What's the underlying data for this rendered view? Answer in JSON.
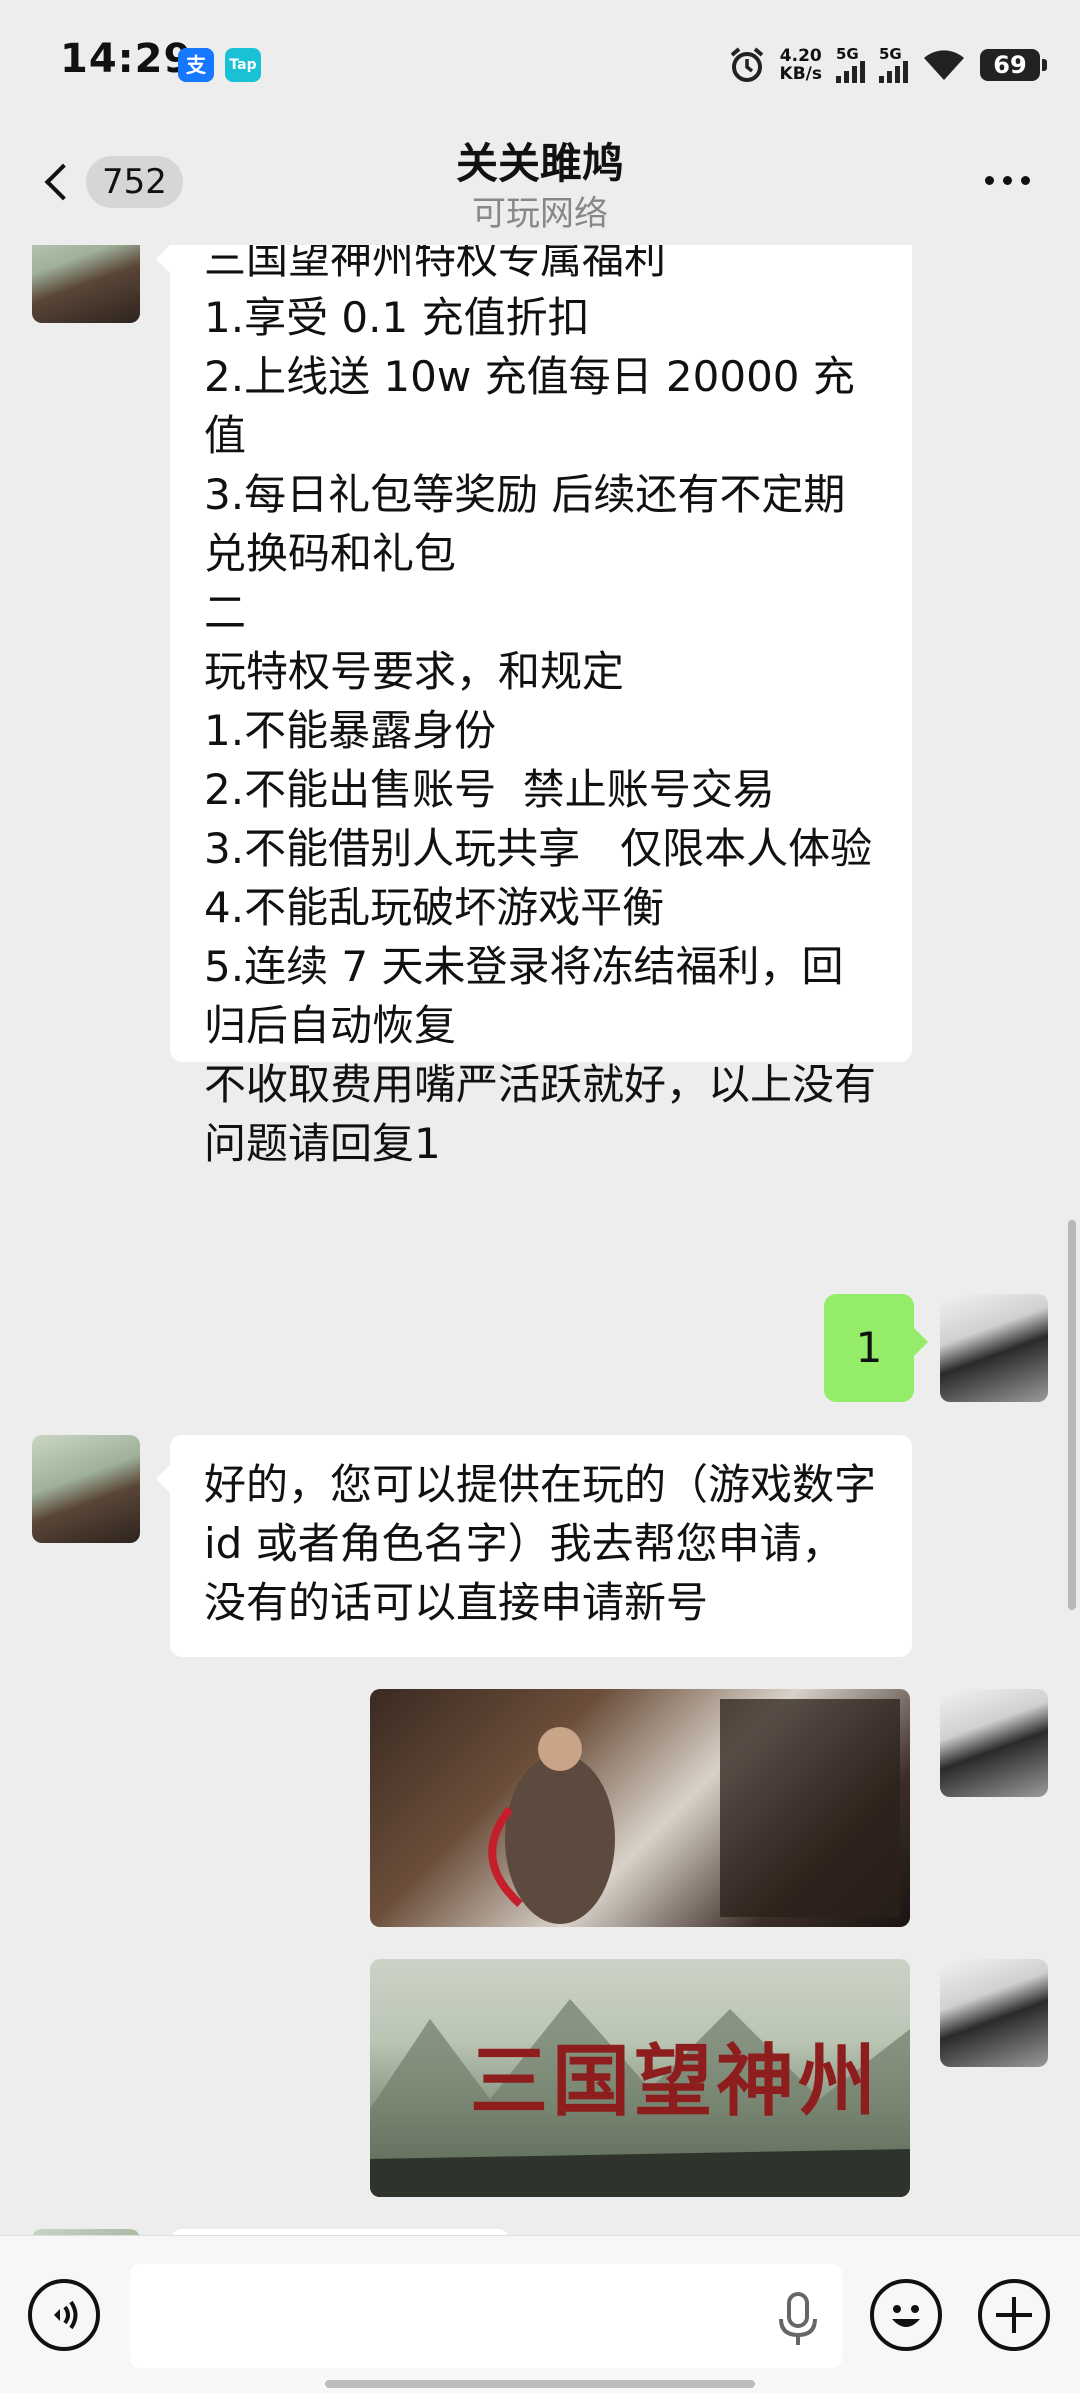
{
  "status_bar": {
    "time": "14:29",
    "app1": "支",
    "app2": "Tap",
    "net_speed_value": "4.20",
    "net_speed_unit": "KB/s",
    "sim1": "5G",
    "sim2": "5G",
    "battery": "69"
  },
  "header": {
    "unread_count": "752",
    "title": "关关雎鸠",
    "subtitle": "可玩网络"
  },
  "messages": [
    {
      "sender": "other",
      "type": "text",
      "text": "三国望神州特权专属福利\n1.享受 0.1 充值折扣\n2.上线送 10w 充值每日 20000 充值\n3.每日礼包等奖励 后续还有不定期兑换码和礼包\n二\n玩特权号要求，和规定\n1.不能暴露身份\n2.不能出售账号  禁止账号交易\n3.不能借别人玩共享   仅限本人体验\n4.不能乱玩破坏游戏平衡\n5.连续 7 天未登录将冻结福利，回归后自动恢复\n不收取费用嘴严活跃就好，以上没有问题请回复1"
    },
    {
      "sender": "me",
      "type": "text",
      "text": "1"
    },
    {
      "sender": "other",
      "type": "text",
      "text": "好的，您可以提供在玩的（游戏数字 id 或者角色名字）我去帮您申请，没有的话可以直接申请新号"
    },
    {
      "sender": "me",
      "type": "image",
      "image_desc": "game-character-screenshot"
    },
    {
      "sender": "me",
      "type": "image",
      "image_desc": "game-title-screenshot",
      "title_text": "三国望神州"
    }
  ],
  "colors": {
    "background": "#ededed",
    "my_bubble": "#95ec69",
    "other_bubble": "#ffffff"
  }
}
